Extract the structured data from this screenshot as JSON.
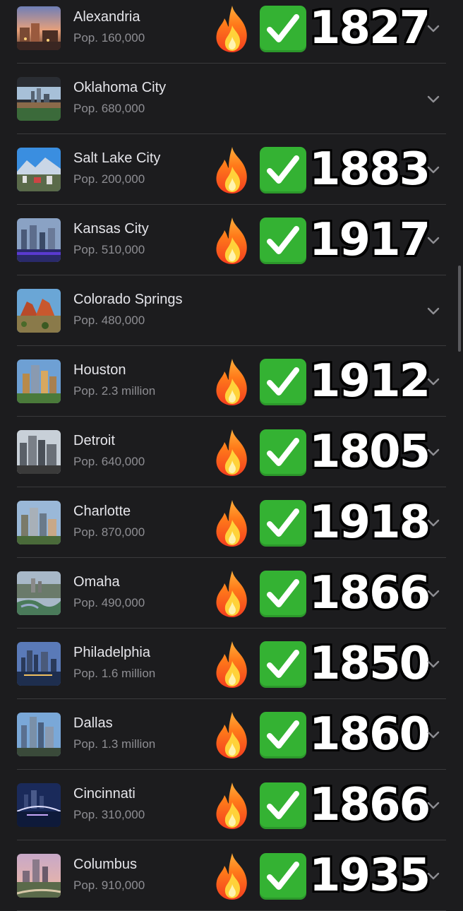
{
  "cities": [
    {
      "name": "Alexandria",
      "pop": "Pop. 160,000",
      "year": "1827",
      "thumb": "sunset-street"
    },
    {
      "name": "Oklahoma City",
      "pop": "Pop. 680,000",
      "year": null,
      "thumb": "dusk-skyline"
    },
    {
      "name": "Salt Lake City",
      "pop": "Pop. 200,000",
      "year": "1883",
      "thumb": "mountain-city"
    },
    {
      "name": "Kansas City",
      "pop": "Pop. 510,000",
      "year": "1917",
      "thumb": "night-blue"
    },
    {
      "name": "Colorado Springs",
      "pop": "Pop. 480,000",
      "year": null,
      "thumb": "red-rocks"
    },
    {
      "name": "Houston",
      "pop": "Pop. 2.3 million",
      "year": "1912",
      "thumb": "golden-towers"
    },
    {
      "name": "Detroit",
      "pop": "Pop. 640,000",
      "year": "1805",
      "thumb": "grey-towers"
    },
    {
      "name": "Charlotte",
      "pop": "Pop. 870,000",
      "year": "1918",
      "thumb": "day-towers"
    },
    {
      "name": "Omaha",
      "pop": "Pop. 490,000",
      "year": "1866",
      "thumb": "river-city"
    },
    {
      "name": "Philadelphia",
      "pop": "Pop. 1.6 million",
      "year": "1850",
      "thumb": "twilight-river"
    },
    {
      "name": "Dallas",
      "pop": "Pop. 1.3 million",
      "year": "1860",
      "thumb": "tall-towers"
    },
    {
      "name": "Cincinnati",
      "pop": "Pop. 310,000",
      "year": "1866",
      "thumb": "night-bridge"
    },
    {
      "name": "Columbus",
      "pop": "Pop. 910,000",
      "year": "1935",
      "thumb": "pink-sky"
    }
  ],
  "icons": {
    "fire": "fire-icon",
    "check": "check-mark-button-icon",
    "chevron": "chevron-down-icon"
  },
  "colors": {
    "background": "#1c1c1e",
    "divider": "#3a3a3c",
    "name": "#e5e5ea",
    "pop": "#8e8e93",
    "check": "#34b233"
  }
}
